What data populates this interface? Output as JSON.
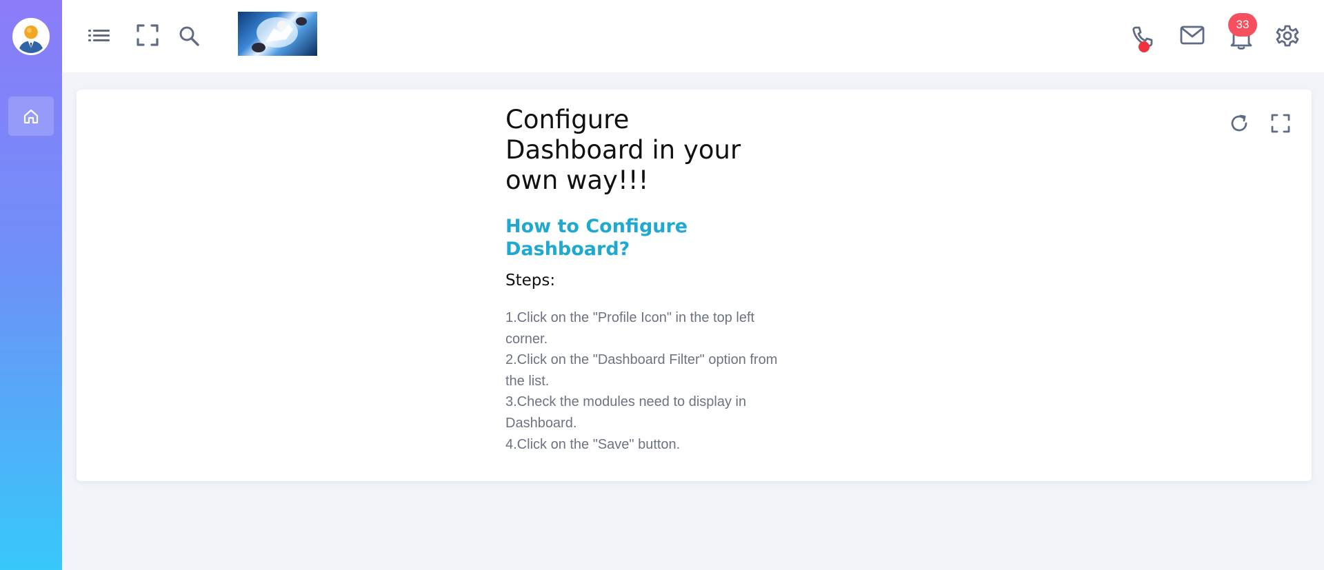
{
  "sidebar": {
    "avatar_icon": "user-avatar",
    "home_icon": "home-icon"
  },
  "topbar": {
    "icons": [
      "list-icon",
      "fullscreen-icon",
      "search-icon",
      "phone-icon",
      "mail-icon",
      "bell-icon",
      "gear-icon"
    ],
    "notification_count": "33",
    "colors": {
      "badge": "#f6505f",
      "call_dot": "#f0323f",
      "icon": "#5f6a84"
    }
  },
  "card": {
    "title": "Configure Dashboard in your own way!!!",
    "subtitle": "How to Configure Dashboard?",
    "steps_label": "Steps:",
    "steps": [
      "1.Click on the \"Profile Icon\" in the top left corner.",
      "2.Click on the \"Dashboard Filter\" option from the list.",
      "3.Check the modules need to display in Dashboard.",
      "4.Click on the \"Save\" button."
    ],
    "tools": [
      "refresh-icon",
      "expand-icon"
    ],
    "colors": {
      "subtitle": "#1fa8d0",
      "steps_text": "#6d7283"
    }
  }
}
